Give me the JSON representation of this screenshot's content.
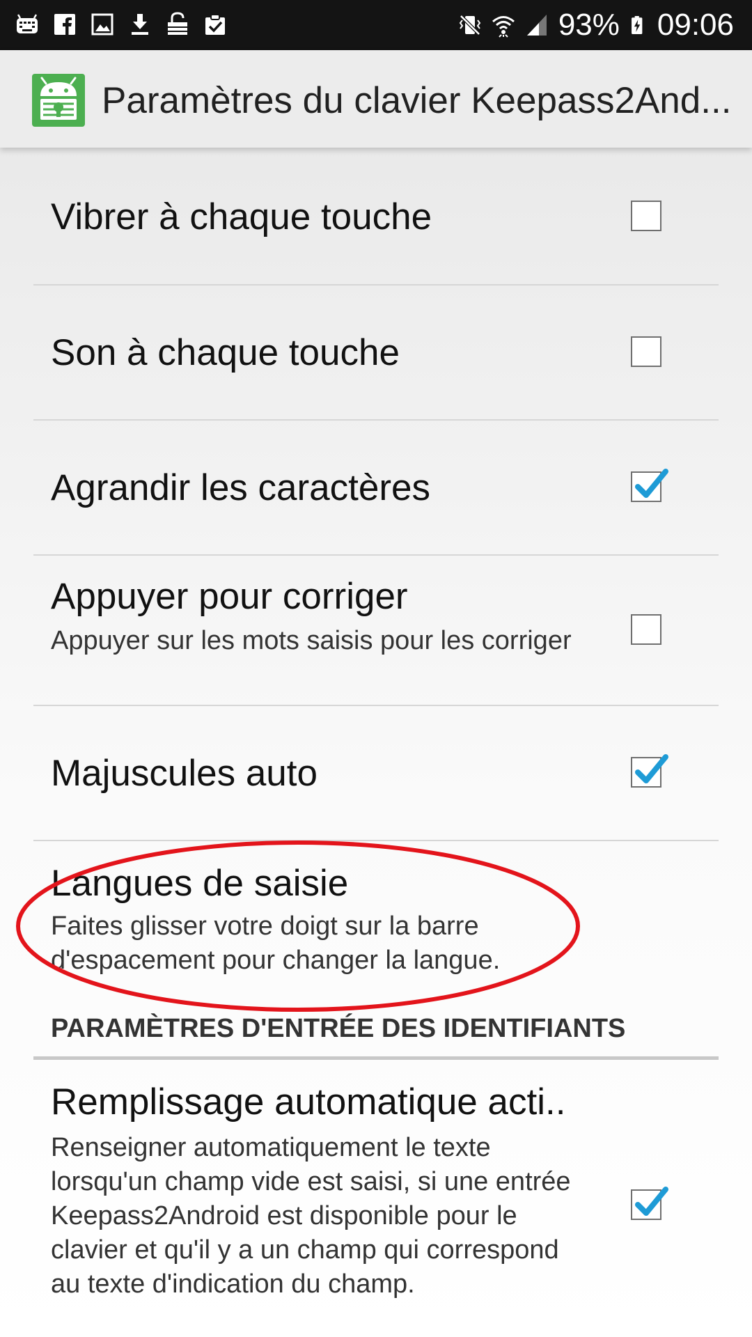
{
  "status_bar": {
    "left_icons": [
      "keyboard-icon",
      "facebook-icon",
      "image-icon",
      "download-icon",
      "lock-icon",
      "clipboard-check-icon"
    ],
    "right_icons": [
      "vibrate-icon",
      "wifi-icon",
      "signal-icon",
      "battery-charging-icon"
    ],
    "battery": "93%",
    "time": "09:06"
  },
  "action_bar": {
    "title": "Paramètres du clavier Keepass2And...",
    "icon": "keepass2android-app-icon",
    "icon_color": "#4caf50"
  },
  "settings": [
    {
      "title": "Vibrer à chaque touche",
      "subtitle": "",
      "checked": false
    },
    {
      "title": "Son à chaque touche",
      "subtitle": "",
      "checked": false
    },
    {
      "title": "Agrandir les caractères",
      "subtitle": "",
      "checked": true
    },
    {
      "title": "Appuyer pour corriger",
      "subtitle": "Appuyer sur les mots saisis pour les corriger",
      "checked": false
    },
    {
      "title": "Majuscules auto",
      "subtitle": "",
      "checked": true
    },
    {
      "title": "Langues de saisie",
      "subtitle": "Faites glisser votre doigt sur la barre d'espacement pour changer la langue."
    }
  ],
  "section_header": "PARAMÈTRES D'ENTRÉE DES IDENTIFIANTS",
  "credential_settings": [
    {
      "title": "Remplissage automatique acti..",
      "subtitle": "Renseigner automatiquement le texte lorsqu'un champ vide est saisi, si une entrée Keepass2Android est disponible pour le clavier et qu'il y a un champ qui correspond au texte d'indication du champ.",
      "checked": true
    }
  ],
  "colors": {
    "check_accent": "#1e9bd6",
    "highlight_oval": "#e3141b"
  }
}
